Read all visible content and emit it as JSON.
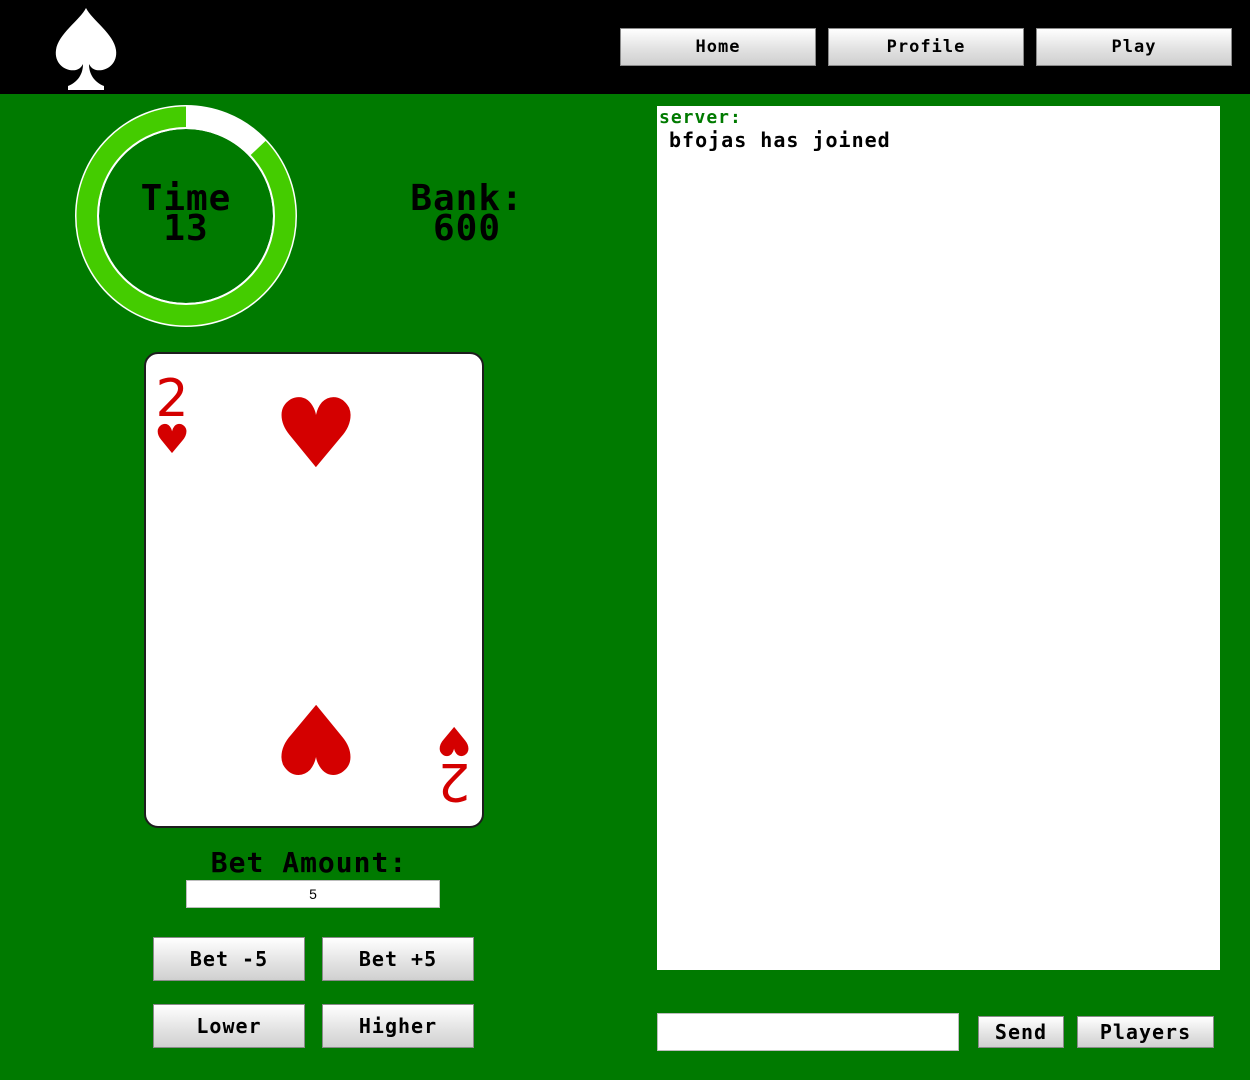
{
  "nav": {
    "home_label": "Home",
    "profile_label": "Profile",
    "play_label": "Play"
  },
  "timer": {
    "label": "Time",
    "value": "13",
    "remaining_fraction": 0.87,
    "ring_color": "#44cc00",
    "track_color": "#ffffff"
  },
  "bank": {
    "label": "Bank:",
    "value": "600"
  },
  "card": {
    "rank": "2",
    "suit": "♥",
    "color": "#d40000"
  },
  "bet": {
    "label": "Bet Amount:",
    "amount": "5",
    "decrease_label": "Bet -5",
    "increase_label": "Bet +5",
    "lower_label": "Lower",
    "higher_label": "Higher"
  },
  "chat": {
    "messages": [
      {
        "user": "server:",
        "text": "bfojas has joined"
      }
    ],
    "input_value": "",
    "send_label": "Send",
    "players_label": "Players"
  },
  "colors": {
    "table_green": "#007a00",
    "topbar": "#000000"
  }
}
